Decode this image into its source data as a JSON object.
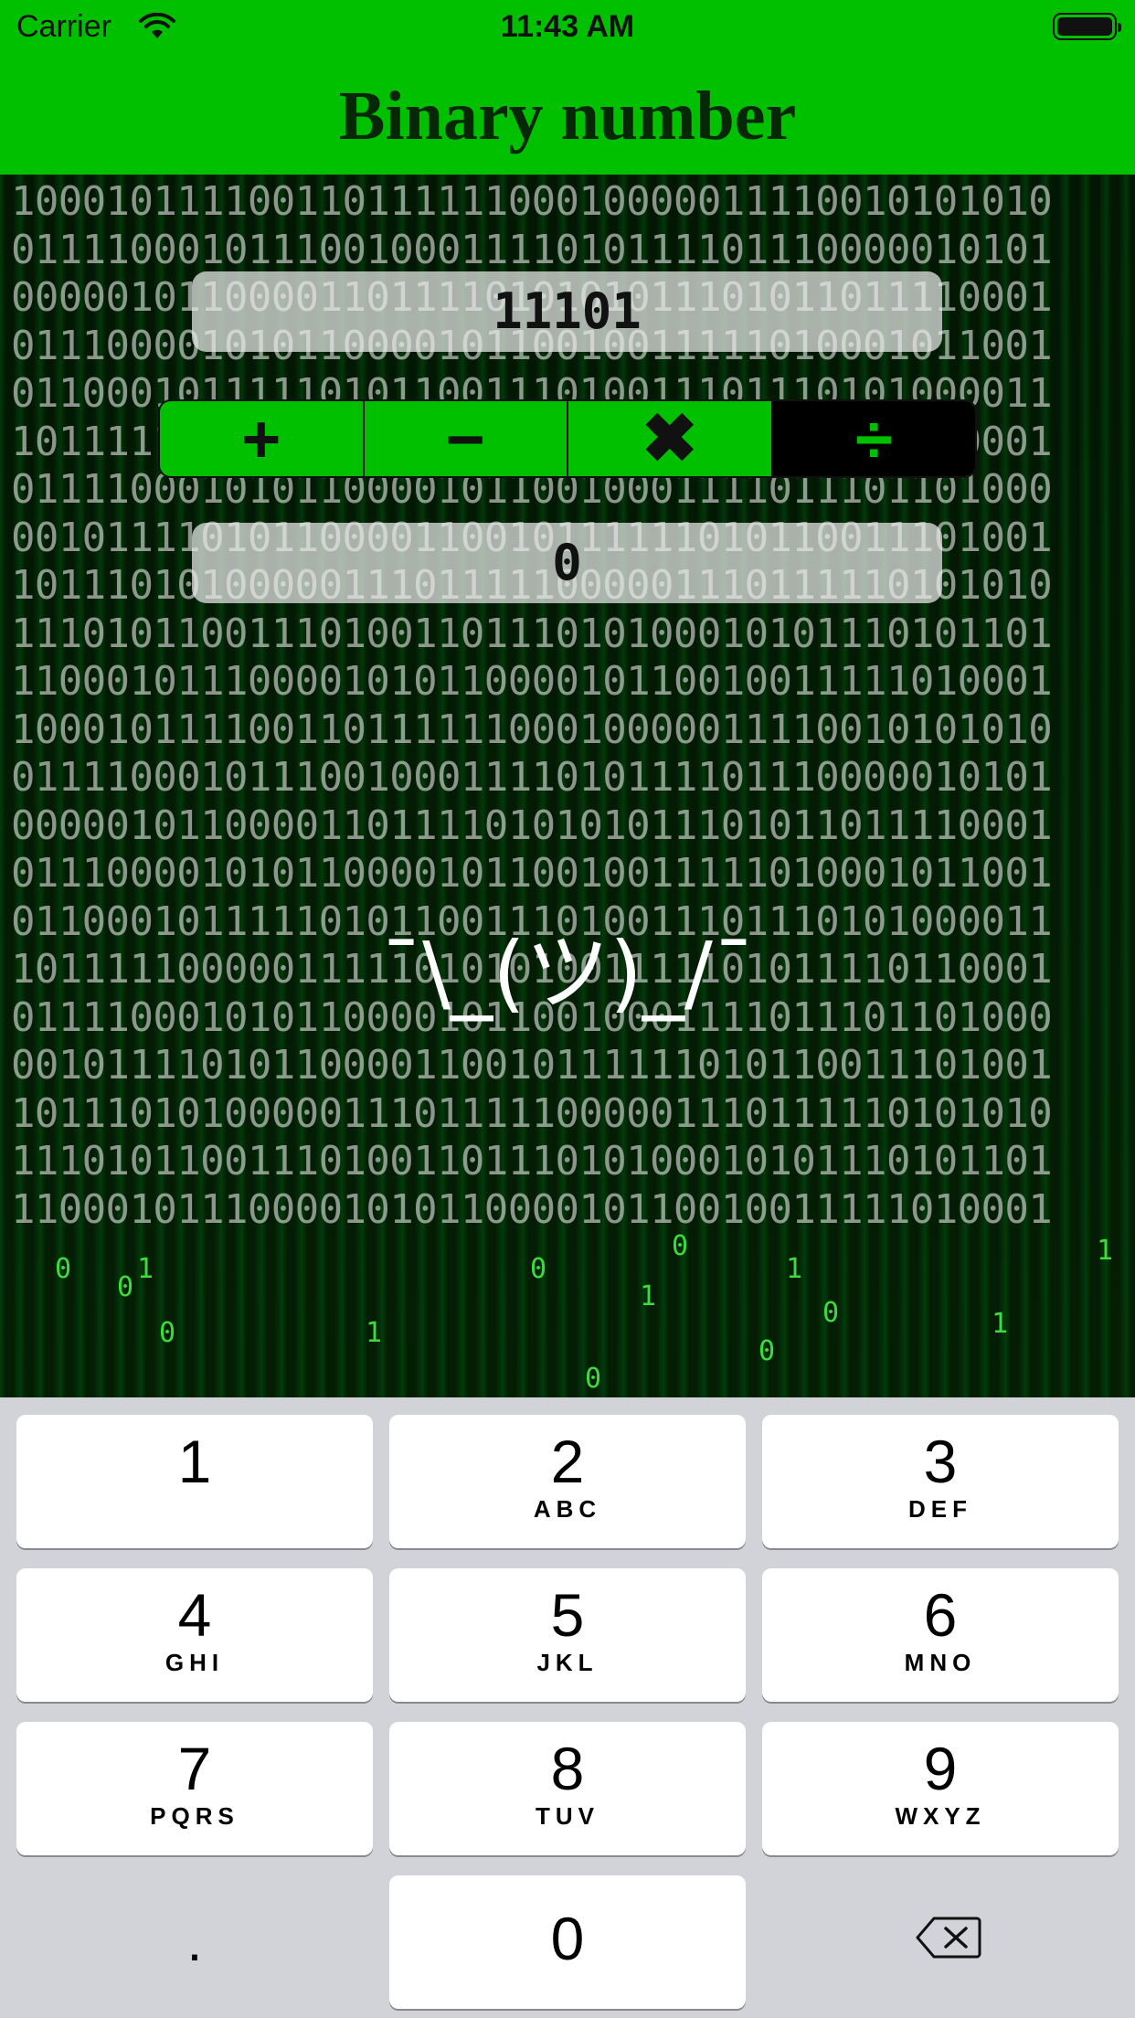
{
  "status": {
    "carrier": "Carrier",
    "time": "11:43 AM"
  },
  "nav": {
    "title": "Binary number"
  },
  "background_text": [
    "10001011110011011111100010000011110010101010",
    "01111000101110010001111010111101110000010101",
    "00000101100001101111010101011101011011110001",
    "01110000101011000010110010011111010001011001",
    "01100010111110101100111010011101110101000011",
    "10111110000011111010101001111101011110110001",
    "01111000101011000010110010001111011101101000",
    "00101111010110000110010111111010110011101001",
    "10111010100000111011111000001110111110101010",
    "11101011001110100110111010100010101110101101",
    "11000101110000101011000010110010011111010001",
    "10001011110011011111100010000011110010101010",
    "01111000101110010001111010111101110000010101",
    "00000101100001101111010101011101011011110001",
    "01110000101011000010110010011111010001011001",
    "01100010111110101100111010011101110101000011",
    "10111110000011111010101001111101011110110001",
    "01111000101011000010110010001111011101101000",
    "00101111010110000110010111111010110011101001",
    "10111010100000111011111000001110111110101010",
    "11101011001110100110111010100010101110101101",
    "11000101110000101011000010110010011111010001"
  ],
  "inputs": {
    "first": "11101",
    "second": "0"
  },
  "operations": [
    "+",
    "−",
    "✖",
    "÷"
  ],
  "selected_operation": "÷",
  "result": "¯\\_(ツ)_/¯",
  "keypad": {
    "keys": [
      {
        "num": "1",
        "letters": ""
      },
      {
        "num": "2",
        "letters": "ABC"
      },
      {
        "num": "3",
        "letters": "DEF"
      },
      {
        "num": "4",
        "letters": "GHI"
      },
      {
        "num": "5",
        "letters": "JKL"
      },
      {
        "num": "6",
        "letters": "MNO"
      },
      {
        "num": "7",
        "letters": "PQRS"
      },
      {
        "num": "8",
        "letters": "TUV"
      },
      {
        "num": "9",
        "letters": "WXYZ"
      }
    ],
    "decimal": ".",
    "zero": "0",
    "delete_icon": "backspace-icon"
  },
  "colors": {
    "accent": "#00c000",
    "keypad_bg": "#d1d3d9"
  }
}
